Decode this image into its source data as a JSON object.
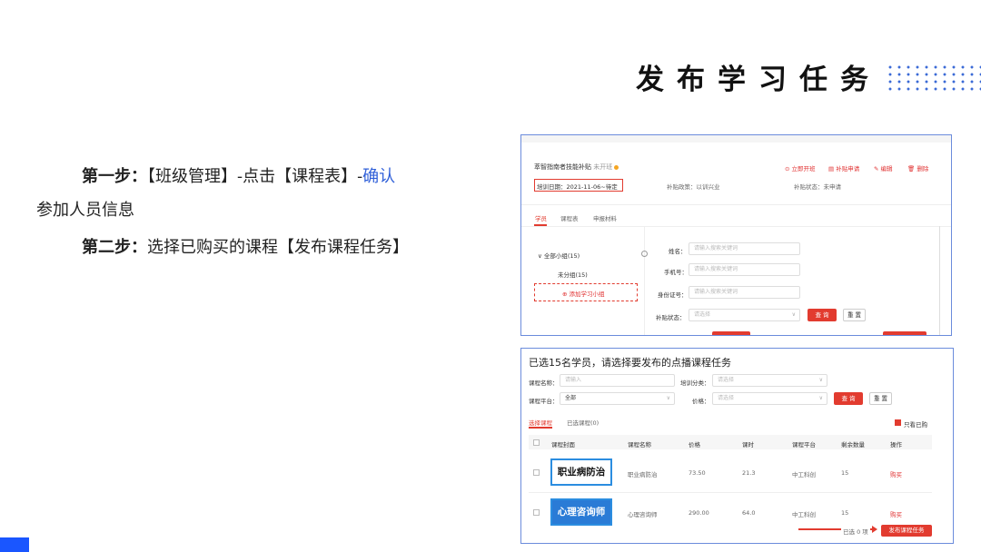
{
  "slide": {
    "title": "发布学习任务",
    "step1_label": "第一步：",
    "step1_text": "【班级管理】-点击【课程表】-",
    "step1_link": "确认",
    "step1_cont": "参加人员信息",
    "step2_label": "第二步：",
    "step2_text": "选择已购买的课程【发布课程任务】"
  },
  "shot1": {
    "project_name": "萃智指南者技能补贴",
    "project_status": "未开班",
    "actions": [
      "立即开班",
      "补贴申请",
      "编辑",
      "删除"
    ],
    "date_label": "培训日期：2021-11-06~待定",
    "subsidy_policy": "补贴政策：以训兴业",
    "subsidy_status": "补贴状态：未申请",
    "tabs": [
      "学员",
      "课程表",
      "申报材料"
    ],
    "group_all": "全部小组(15)",
    "group_ungrouped": "未分组(15)",
    "add_group": "添加学习小组",
    "form": {
      "name_label": "姓名：",
      "name_placeholder": "请输入搜索关键词",
      "phone_label": "手机号：",
      "phone_placeholder": "请输入搜索关键词",
      "id_label": "身份证号：",
      "id_placeholder": "请输入搜索关键词",
      "status_label": "补贴状态：",
      "status_placeholder": "请选择",
      "query_button": "查 询",
      "reset_button": "重 置"
    }
  },
  "shot2": {
    "title": "已选15名学员，请选择要发布的点播课程任务",
    "filters": {
      "course_name_label": "课程名称：",
      "course_name_placeholder": "请输入",
      "category_label": "培训分类：",
      "category_placeholder": "请选择",
      "platform_label": "课程平台：",
      "platform_value": "全部",
      "price_label": "价格：",
      "price_placeholder": "请选择",
      "query_button": "查 询",
      "reset_button": "重 置"
    },
    "tabs": [
      "选择课程",
      "已选课程(0)"
    ],
    "only_purchased": "只看已购",
    "columns": [
      "课程封面",
      "课程名称",
      "价格",
      "课时",
      "课程平台",
      "剩余数量",
      "操作"
    ],
    "rows": [
      {
        "cover": "职业病防治",
        "name": "职业病防治",
        "price": "73.50",
        "hours": "21.3",
        "platform": "中工科创",
        "remaining": "15",
        "action": "购买"
      },
      {
        "cover": "心理咨询师",
        "name": "心理咨询师",
        "price": "290.00",
        "hours": "64.0",
        "platform": "中工科创",
        "remaining": "15",
        "action": "购买"
      }
    ],
    "selected_count": "已选 0 项",
    "publish_button": "发布课程任务"
  }
}
